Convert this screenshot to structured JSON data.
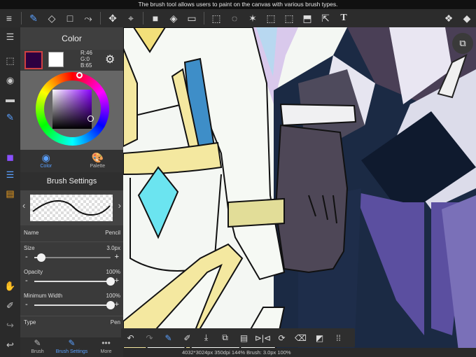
{
  "tooltip": "The brush tool allows users to paint on the canvas with various brush types.",
  "topbar": {
    "tools": [
      "menu-icon",
      "brush-icon",
      "eraser-icon",
      "rectangle-icon",
      "curve-icon",
      "move-icon",
      "snap-icon",
      "fill-color-icon",
      "bucket-icon",
      "gradient-icon",
      "selection-icon",
      "lasso-icon",
      "magic-wand-icon",
      "select-pen-icon",
      "select-eraser-icon",
      "transform-icon",
      "select-arrow-icon",
      "text-icon",
      "materials-icon",
      "layers-icon"
    ]
  },
  "color_panel": {
    "title": "Color",
    "main_color": "#2e0041",
    "sub_color": "#ffffff",
    "r_label": "R:46",
    "g_label": "G:0",
    "b_label": "B:65",
    "tab_color": "Color",
    "tab_palette": "Palette"
  },
  "brush_panel": {
    "title": "Brush Settings",
    "name_label": "Name",
    "name_value": "Pencil",
    "size_label": "Size",
    "size_value": "3.0px",
    "size_fraction": 0.09,
    "opacity_label": "Opacity",
    "opacity_value": "100%",
    "opacity_fraction": 1.0,
    "min_width_label": "Minimum Width",
    "min_width_value": "100%",
    "min_width_fraction": 1.0,
    "type_label": "Type",
    "type_value": "Pen"
  },
  "bottom_tabs": {
    "brush": "Brush",
    "brush_settings": "Brush Settings",
    "more": "More"
  },
  "status": "4032*3024px 350dpi 144% Brush: 3.0px 100%",
  "colors": {
    "accent": "#5aa0ff"
  }
}
